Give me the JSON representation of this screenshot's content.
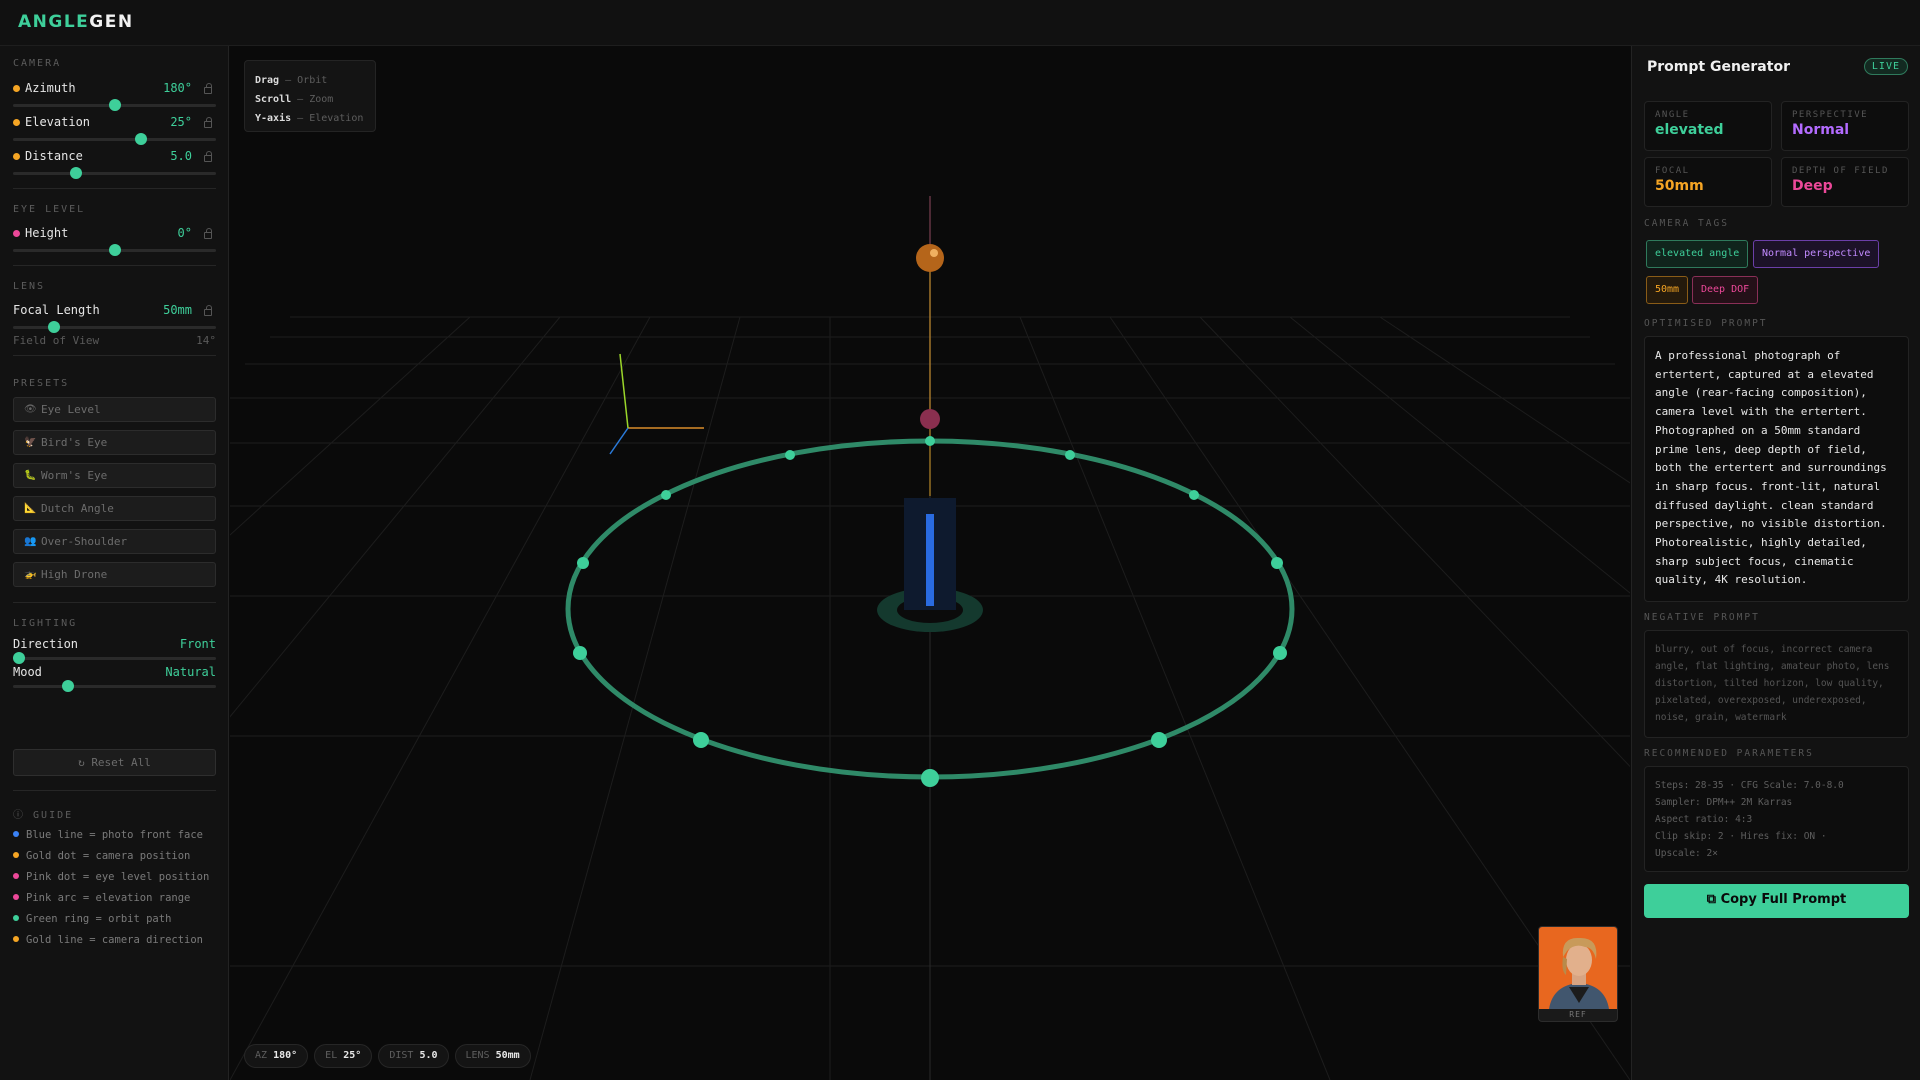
{
  "app": {
    "logo_part1": "ANGLE",
    "logo_part2": "GEN"
  },
  "sidebar": {
    "camera_heading": "CAMERA",
    "azimuth": {
      "label": "Azimuth",
      "value": "180°",
      "level": 0.5
    },
    "elevation": {
      "label": "Elevation",
      "value": "25°",
      "level": 0.63
    },
    "distance": {
      "label": "Distance",
      "value": "5.0",
      "level": 0.31
    },
    "eye_heading": "EYE LEVEL",
    "height": {
      "label": "Height",
      "value": "0°",
      "level": 0.5
    },
    "lens_heading": "LENS",
    "focal": {
      "label": "Focal Length",
      "value": "50mm",
      "level": 0.2
    },
    "fov": {
      "label": "Field of View",
      "value": "14°"
    },
    "presets_heading": "PRESETS",
    "presets": [
      "Eye Level",
      "Bird's Eye",
      "Worm's Eye",
      "Dutch Angle",
      "Over-Shoulder",
      "High Drone"
    ],
    "lighting_heading": "LIGHTING",
    "direction": {
      "label": "Direction",
      "value": "Front",
      "level": 0.03
    },
    "mood": {
      "label": "Mood",
      "value": "Natural",
      "level": 0.27
    },
    "reset_label": "Reset All",
    "guide_heading": "GUIDE",
    "guide": [
      {
        "text": "Blue line = photo front face",
        "color": "#3b82f6"
      },
      {
        "text": "Gold dot = camera position",
        "color": "#f5a524"
      },
      {
        "text": "Pink dot = eye level position",
        "color": "#ec4899"
      },
      {
        "text": "Pink arc = elevation range",
        "color": "#ec4899"
      },
      {
        "text": "Green ring = orbit path",
        "color": "#3ecf9a"
      },
      {
        "text": "Gold line = camera direction",
        "color": "#f5a524"
      }
    ]
  },
  "viewport": {
    "hint": [
      {
        "key": "Drag",
        "action": "Orbit"
      },
      {
        "key": "Scroll",
        "action": "Zoom"
      },
      {
        "key": "Y-axis",
        "action": "Elevation"
      }
    ],
    "chips": [
      {
        "key": "AZ",
        "value": "180°"
      },
      {
        "key": "EL",
        "value": "25°"
      },
      {
        "key": "DIST",
        "value": "5.0"
      },
      {
        "key": "LENS",
        "value": "50mm"
      }
    ],
    "ref_label": "REF"
  },
  "panel": {
    "title": "Prompt Generator",
    "live": "LIVE",
    "cards": [
      {
        "label": "ANGLE",
        "value": "elevated",
        "color": "#3ecf9a"
      },
      {
        "label": "PERSPECTIVE",
        "value": "Normal",
        "color": "#b36bff"
      },
      {
        "label": "FOCAL",
        "value": "50mm",
        "color": "#f5a524"
      },
      {
        "label": "DEPTH OF FIELD",
        "value": "Deep",
        "color": "#ec4899"
      }
    ],
    "tags_heading": "CAMERA TAGS",
    "tags": [
      {
        "text": "elevated angle",
        "color": "#3ecf9a"
      },
      {
        "text": "Normal perspective",
        "color": "#b36bff"
      },
      {
        "text": "50mm",
        "color": "#f5a524"
      },
      {
        "text": "Deep DOF",
        "color": "#ec4899"
      }
    ],
    "prompt_heading": "OPTIMISED PROMPT",
    "prompt": "A professional photograph of ertertert, captured at a elevated angle (rear-facing composition), camera level with the ertertert. Photographed on a 50mm standard prime lens, deep depth of field, both the ertertert and surroundings in sharp focus. front-lit, natural diffused daylight. clean standard perspective, no visible distortion. Photorealistic, highly detailed, sharp subject focus, cinematic quality, 4K resolution.",
    "negative_heading": "NEGATIVE PROMPT",
    "negative": "blurry, out of focus, incorrect camera angle, flat lighting, amateur photo, lens distortion, tilted horizon, low quality, pixelated, overexposed, underexposed, noise, grain, watermark",
    "params_heading": "RECOMMENDED PARAMETERS",
    "params": [
      "Steps: 28-35  ·  CFG Scale: 7.0-8.0",
      "Sampler: DPM++ 2M Karras",
      "Aspect ratio: 4:3",
      "Clip skip: 2  ·  Hires fix: ON  ·",
      "Upscale: 2×"
    ],
    "copy_label": "Copy Full Prompt"
  }
}
